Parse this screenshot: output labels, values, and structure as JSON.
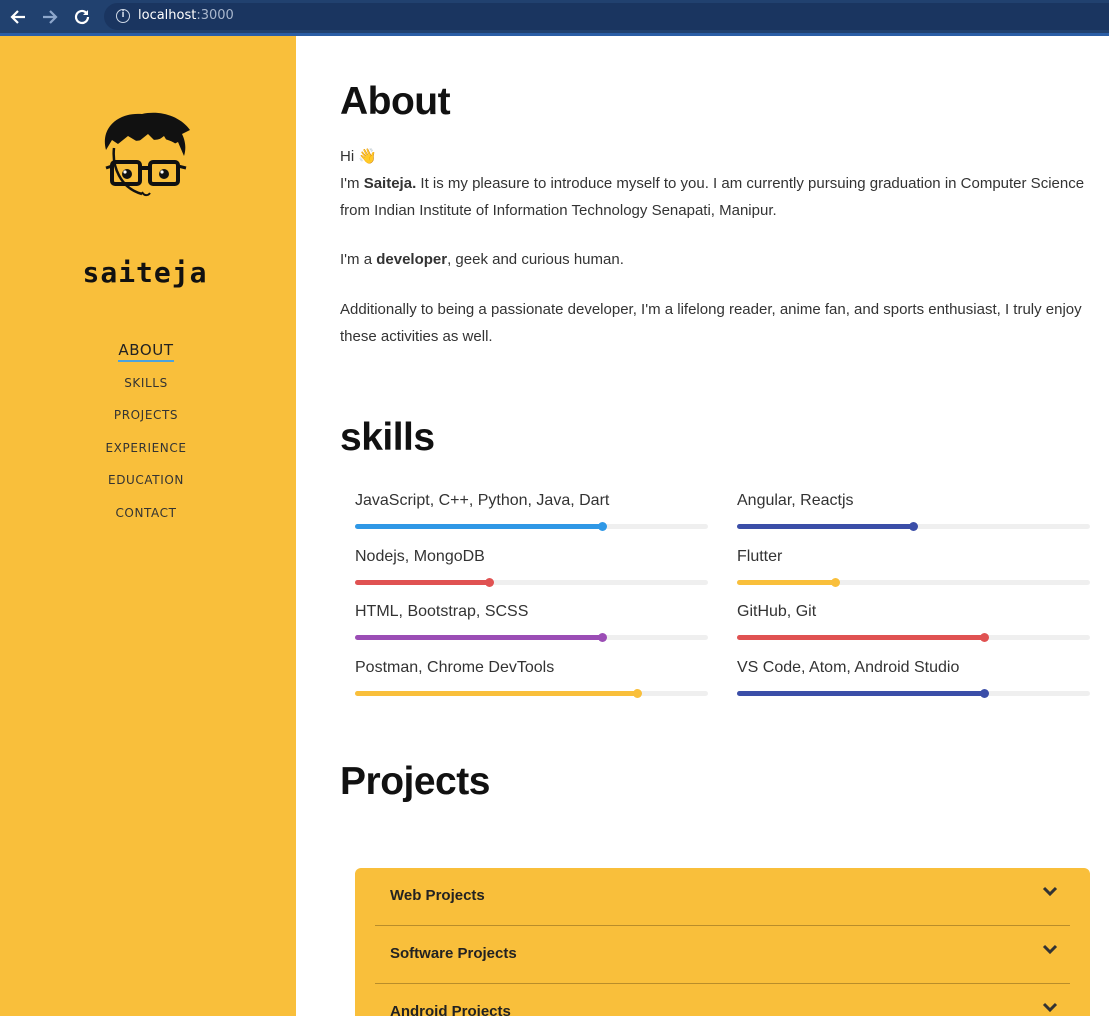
{
  "browser": {
    "url_host": "localhost",
    "url_port": ":3000"
  },
  "sidebar": {
    "brand": "saiteja",
    "menu": [
      "ABOUT",
      "SKILLS",
      "PROJECTS",
      "EXPERIENCE",
      "EDUCATION",
      "CONTACT"
    ],
    "active_index": 0,
    "accent_color": "#f9bf3b"
  },
  "about": {
    "title": "About",
    "greeting": "Hi 👋",
    "intro_pre": "I'm ",
    "intro_name": "Saiteja.",
    "intro_post": " It is my pleasure to introduce myself to you. I am currently pursuing graduation in Computer Science from Indian Institute of Information Technology Senapati, Manipur.",
    "dev_pre": "I'm a ",
    "dev_bold": "developer",
    "dev_post": ", geek and curious human.",
    "extra": "Additionally to being a passionate developer, I'm a lifelong reader, anime fan, and sports enthusiast, I truly enjoy these activities as well."
  },
  "skills": {
    "title": "skills",
    "items": [
      {
        "label": "JavaScript, C++, Python, Java, Dart",
        "level": 0.7,
        "color": "#2f98e6"
      },
      {
        "label": "Angular, Reactjs",
        "level": 0.5,
        "color": "#3b4ea8"
      },
      {
        "label": "Nodejs, MongoDB",
        "level": 0.38,
        "color": "#e05252"
      },
      {
        "label": "Flutter",
        "level": 0.28,
        "color": "#f9bf3b"
      },
      {
        "label": "HTML, Bootstrap, SCSS",
        "level": 0.7,
        "color": "#9b4db5"
      },
      {
        "label": "GitHub, Git",
        "level": 0.7,
        "color": "#e05252"
      },
      {
        "label": "Postman, Chrome DevTools",
        "level": 0.8,
        "color": "#f9bf3b"
      },
      {
        "label": "VS Code, Atom, Android Studio",
        "level": 0.7,
        "color": "#3b4ea8"
      }
    ]
  },
  "projects": {
    "title": "Projects",
    "sections": [
      "Web Projects",
      "Software Projects",
      "Android Projects"
    ]
  }
}
